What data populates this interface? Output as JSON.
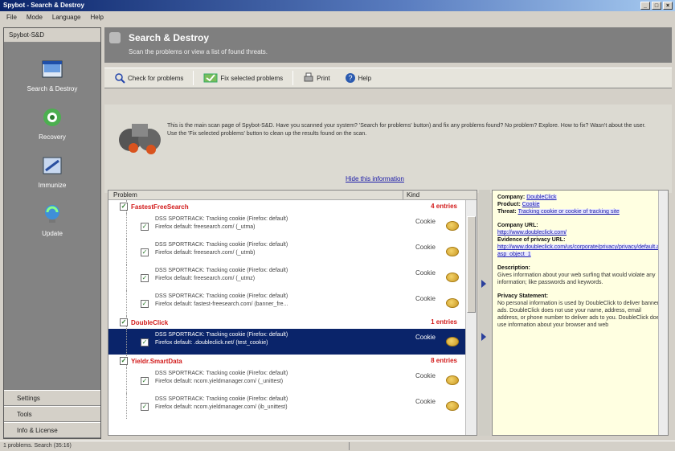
{
  "window": {
    "title": "Spybot - Search & Destroy",
    "controls": [
      "_",
      "□",
      "×"
    ]
  },
  "menu": [
    "File",
    "Mode",
    "Language",
    "Help"
  ],
  "sidebar": {
    "header": "Spybot-S&D",
    "items": [
      {
        "label": "Search & Destroy",
        "icon": "search-destroy-icon"
      },
      {
        "label": "Recovery",
        "icon": "recovery-icon"
      },
      {
        "label": "Immunize",
        "icon": "immunize-icon"
      },
      {
        "label": "Update",
        "icon": "update-icon"
      }
    ],
    "bottom": [
      "Settings",
      "Tools",
      "Info & License"
    ]
  },
  "banner": {
    "title": "Search & Destroy",
    "subtitle": "Scan the problems or view a list of found threats."
  },
  "toolbar": {
    "check": "Check for problems",
    "fix": "Fix selected problems",
    "print": "Print",
    "help": "Help"
  },
  "intro": {
    "text": "This is the main scan page of Spybot-S&D. Have you scanned your system? 'Search for problems' button) and fix any problems found? No problem? Explore. How to fix? Wasn't about the user. Use the 'Fix selected problems' button to clean up the results found on the scan.",
    "link": "Hide this information"
  },
  "list": {
    "col_problem": "Problem",
    "col_kind": "Kind",
    "groups": [
      {
        "name": "FastestFreeSearch",
        "count": "4 entries",
        "items": [
          {
            "l1": "DSS SPORTRACK: Tracking cookie (Firefox: default)",
            "l2": "Firefox default: freesearch.com/ (_utma)",
            "kind": "Cookie",
            "selected": false
          },
          {
            "l1": "DSS SPORTRACK: Tracking cookie (Firefox: default)",
            "l2": "Firefox default: freesearch.com/ (_utmb)",
            "kind": "Cookie",
            "selected": false
          },
          {
            "l1": "DSS SPORTRACK: Tracking cookie (Firefox: default)",
            "l2": "Firefox default: freesearch.com/ (_utmz)",
            "kind": "Cookie",
            "selected": false
          },
          {
            "l1": "DSS SPORTRACK: Tracking cookie (Firefox: default)",
            "l2": "Firefox default: fastest-freesearch.com/ (banner_fre...",
            "kind": "Cookie",
            "selected": false
          }
        ]
      },
      {
        "name": "DoubleClick",
        "count": "1 entries",
        "items": [
          {
            "l1": "DSS SPORTRACK: Tracking cookie (Firefox: default)",
            "l2": "Firefox default: .doubleclick.net/ (test_cookie)",
            "kind": "Cookie",
            "selected": true
          }
        ]
      },
      {
        "name": "Yieldr.SmartData",
        "count": "8 entries",
        "items": [
          {
            "l1": "DSS SPORTRACK: Tracking cookie (Firefox: default)",
            "l2": "Firefox default: ncom.yieldmanager.com/ (_unittest)",
            "kind": "Cookie",
            "selected": false
          },
          {
            "l1": "DSS SPORTRACK: Tracking cookie (Firefox: default)",
            "l2": "Firefox default: ncom.yieldmanager.com/ (ib_unittest)",
            "kind": "Cookie",
            "selected": false
          }
        ]
      }
    ]
  },
  "detail": {
    "company_label": "Company:",
    "company": "DoubleClick",
    "product_label": "Product:",
    "product": "Cookie",
    "threat_label": "Threat:",
    "threat": "Tracking cookie or cookie of tracking site",
    "companyurl_label": "Company URL:",
    "companyurl": "http://www.doubleclick.com/",
    "privacyurl_label": "Evidence of privacy URL:",
    "privacyurl": "http://www.doubleclick.com/us/corporate/privacy/privacy/default.asp?asp_object_1",
    "desc_label": "Description:",
    "desc": "Gives information about your web surfing that would violate any information; like passwords and keywords.",
    "privacy_label": "Privacy Statement:",
    "privacy": "No personal information is used by DoubleClick to deliver banner ads. DoubleClick does not use your name, address, email address, or phone number to deliver ads to you. DoubleClick does use information about your browser and web"
  },
  "status": "1 problems. Search (35:16)"
}
